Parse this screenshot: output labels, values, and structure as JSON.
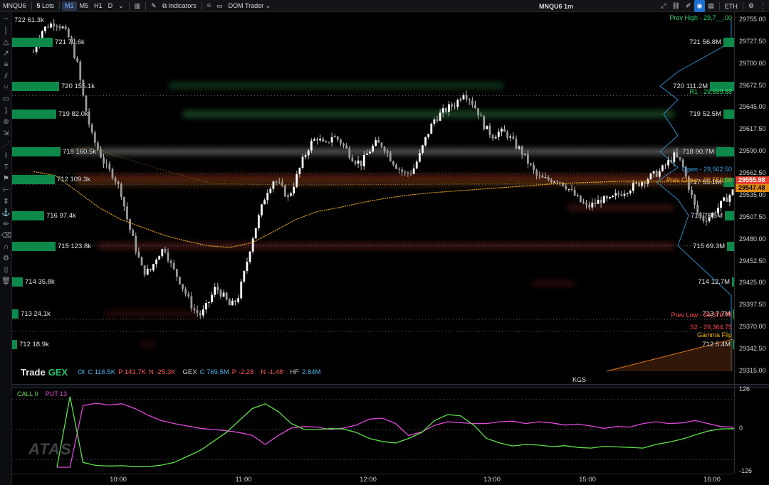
{
  "toolbar": {
    "symbol": "MNQU6",
    "lots": "5",
    "lots_label": "Lots",
    "timeframes": [
      "M1",
      "M5",
      "H1",
      "D"
    ],
    "active_timeframe": "M1",
    "indicators_label": "Indicators",
    "dom_trader_label": "DOM Trader",
    "title": "MNQU6 1m",
    "session_label": "ETH"
  },
  "colors": {
    "gex_green": "#0d8a4a",
    "call": "#5fe04a",
    "put": "#e04ad9",
    "candle": "#f2f2f2",
    "prev_high": "#2ecf6a",
    "r1": "#2ecf6a",
    "open": "#3ea6e8",
    "prev_close": "#f0a020",
    "prev_low": "#ff4b4b",
    "s2": "#ff4b4b",
    "gamma_flip": "#f5b400",
    "price_tag_red": "#e8412f",
    "price_tag_orange": "#e08b10"
  },
  "gex_left": [
    {
      "label": "722  61.3k",
      "price": 29755,
      "w": 0
    },
    {
      "label": "721  70.6k",
      "price": 29727.5,
      "w": 57
    },
    {
      "label": "720  155.1k",
      "price": 29672.5,
      "w": 66
    },
    {
      "label": "719  82.0k",
      "price": 29637,
      "w": 62
    },
    {
      "label": "718  160.5k",
      "price": 29590,
      "w": 68
    },
    {
      "label": "712  109.3k",
      "price": 29555,
      "w": 60
    },
    {
      "label": "716  97.4k",
      "price": 29510,
      "w": 45
    },
    {
      "label": "715  123.8k",
      "price": 29472,
      "w": 61
    },
    {
      "label": "714  35.8k",
      "price": 29427,
      "w": 15
    },
    {
      "label": "713  24.1k",
      "price": 29387,
      "w": 9
    },
    {
      "label": "712  18.9k",
      "price": 29349,
      "w": 7
    }
  ],
  "gex_right": [
    {
      "label": "721  56.8M",
      "price": 29727.5,
      "w": 15
    },
    {
      "label": "720  111.2M",
      "price": 29672.5,
      "w": 34
    },
    {
      "label": "719  52.5M",
      "price": 29637,
      "w": 15
    },
    {
      "label": "718  90.7M",
      "price": 29590,
      "w": 25
    },
    {
      "label": "717  55.1M",
      "price": 29552,
      "w": 15
    },
    {
      "label": "716  76.5M",
      "price": 29510,
      "w": 13
    },
    {
      "label": "715  69.3M",
      "price": 29472,
      "w": 10
    },
    {
      "label": "714  12.7M",
      "price": 29427,
      "w": 3
    },
    {
      "label": "713  7.7M",
      "price": 29387,
      "w": 2
    },
    {
      "label": "712  5.4M",
      "price": 29349,
      "w": 2
    }
  ],
  "levels": [
    {
      "label": "Prev High - 29,7__.00",
      "price": 29752,
      "color": "#2ecf6a"
    },
    {
      "label": "R1 - 29,659.88",
      "price": 29660,
      "color": "#2ecf6a"
    },
    {
      "label": "Open - 29,562.50",
      "price": 29562.5,
      "color": "#3ea6e8"
    },
    {
      "label": "Prev Close - 29,559.00",
      "price": 29549,
      "color": "#f0a020"
    },
    {
      "label": "Prev Low - 29,379.75",
      "price": 29380,
      "color": "#ff4b4b"
    },
    {
      "label": "S2 - 29,364.75",
      "price": 29365,
      "color": "#ff4b4b"
    },
    {
      "label": "Gamma Flip",
      "price": 29355,
      "color": "#f5b400"
    }
  ],
  "infobar": {
    "logo_a": "Trade",
    "logo_b": "GEX",
    "oi_label": "OI",
    "oi_c": "C 116.5K",
    "oi_p": "P 141.7K",
    "oi_n": "N -25.3K",
    "gex_label": "GEX",
    "gex_c": "C 769.5M",
    "gex_p": "P -2.28",
    "gex_n": "N -1.48",
    "hf_label": "HF",
    "hf_v": "2.84M"
  },
  "kgs_label": "KGS",
  "price_axis": {
    "ticks": [
      "29755.00",
      "29727.50",
      "29700.00",
      "29672.50",
      "29645.00",
      "29617.50",
      "29590.00",
      "29562.50",
      "29535.00",
      "29507.50",
      "29480.00",
      "29452.50",
      "29425.00",
      "29397.50",
      "29370.00",
      "29342.50",
      "29315.00"
    ],
    "tag_current": "29555.98",
    "tag_prev": "29547.48"
  },
  "sub_axis": {
    "top": "126",
    "mid": "0",
    "bottom": "-126"
  },
  "sub_legend": {
    "call": "CALL 0",
    "put": "PUT 13"
  },
  "time_axis": [
    "10:00",
    "11:00",
    "12:00",
    "13:00",
    "15:00",
    "16:00"
  ],
  "watermark": "ATAS",
  "chart_data": {
    "type": "candlestick",
    "symbol": "MNQU6",
    "interval": "1m",
    "x_labels": [
      "10:00",
      "11:00",
      "12:00",
      "13:00",
      "15:00",
      "16:00"
    ],
    "ylim": [
      29315,
      29762
    ],
    "close_path": [
      29715,
      29740,
      29748,
      29752,
      29745,
      29730,
      29700,
      29650,
      29610,
      29590,
      29570,
      29560,
      29540,
      29500,
      29470,
      29440,
      29440,
      29460,
      29470,
      29445,
      29430,
      29410,
      29392,
      29385,
      29400,
      29420,
      29410,
      29396,
      29405,
      29440,
      29480,
      29510,
      29540,
      29555,
      29545,
      29532,
      29555,
      29580,
      29600,
      29608,
      29596,
      29610,
      29604,
      29592,
      29580,
      29575,
      29590,
      29600,
      29598,
      29582,
      29570,
      29562,
      29565,
      29585,
      29610,
      29630,
      29638,
      29645,
      29650,
      29665,
      29655,
      29640,
      29620,
      29610,
      29615,
      29612,
      29600,
      29590,
      29575,
      29560,
      29555,
      29555,
      29555,
      29548,
      29538,
      29528,
      29520,
      29525,
      29530,
      29528,
      29535,
      29540,
      29545,
      29550,
      29555,
      29560,
      29565,
      29575,
      29585,
      29575,
      29545,
      29515,
      29505,
      29510,
      29520,
      29530,
      29540
    ],
    "vwap_path": [
      29565,
      29560,
      29540,
      29520,
      29505,
      29495,
      29485,
      29478,
      29472,
      29470,
      29476,
      29490,
      29505,
      29515,
      29520,
      29526,
      29531,
      29535,
      29538,
      29540,
      29542,
      29544,
      29546,
      29548,
      29550,
      29551,
      29552,
      29553,
      29553,
      29553,
      29553,
      29552,
      29552
    ],
    "call_path": [
      -126,
      110,
      -110,
      -120,
      -122,
      -121,
      -124,
      -124,
      -119,
      -110,
      -90,
      -70,
      -40,
      -10,
      30,
      70,
      86,
      60,
      20,
      0,
      0,
      3,
      2,
      -10,
      -30,
      -40,
      -45,
      -30,
      -10,
      30,
      50,
      46,
      15,
      -30,
      -45,
      -55,
      -50,
      -52,
      -57,
      -54,
      -60,
      -62,
      -56,
      -58,
      -60,
      -62,
      -50,
      -42,
      -32,
      -18,
      -5,
      2,
      3
    ],
    "put_path": [
      -126,
      -126,
      80,
      88,
      82,
      86,
      70,
      48,
      30,
      20,
      12,
      4,
      0,
      -4,
      -10,
      -20,
      -50,
      -20,
      5,
      10,
      8,
      0,
      5,
      15,
      35,
      38,
      20,
      -20,
      -8,
      14,
      26,
      23,
      20,
      20,
      26,
      28,
      20,
      26,
      22,
      15,
      18,
      12,
      4,
      10,
      8,
      20,
      26,
      20,
      22,
      30,
      20,
      10,
      8
    ]
  }
}
